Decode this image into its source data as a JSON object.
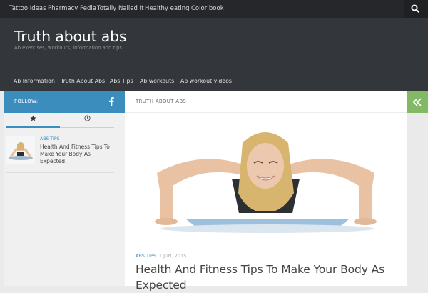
{
  "top_nav": {
    "items": [
      "Tattoo Ideas",
      "Pharmacy Pedia",
      "Totally Nailed It",
      "Healthy eating",
      "Color book"
    ],
    "search_icon": "search-icon"
  },
  "header": {
    "site_title": "Truth about abs",
    "tagline": "Ab exercises, workouts, information and tips"
  },
  "main_nav": {
    "items": [
      "Ab Information",
      "Truth About Abs",
      "Abs Tips",
      "Ab workouts",
      "Ab workout videos"
    ]
  },
  "sidebar": {
    "follow_label": "FOLLOW:",
    "follow_icon": "facebook-icon",
    "tabs": [
      {
        "icon": "star-icon",
        "active": true
      },
      {
        "icon": "clock-icon",
        "active": false
      }
    ],
    "posts": [
      {
        "category": "ABS TIPS",
        "title": "Health And Fitness Tips To Make Your Body As Expected"
      }
    ]
  },
  "content": {
    "breadcrumb": "TRUTH ABOUT ABS",
    "collapse_icon": "double-chevron-left-icon",
    "post": {
      "category": "ABS TIPS",
      "date": "1 JUN, 2015",
      "title": "Health And Fitness Tips To Make Your Body As Expected"
    }
  },
  "colors": {
    "top_nav_bg": "#26272b",
    "header_bg": "#33363b",
    "accent_blue": "#3b8dbd",
    "accent_green": "#82b965"
  }
}
